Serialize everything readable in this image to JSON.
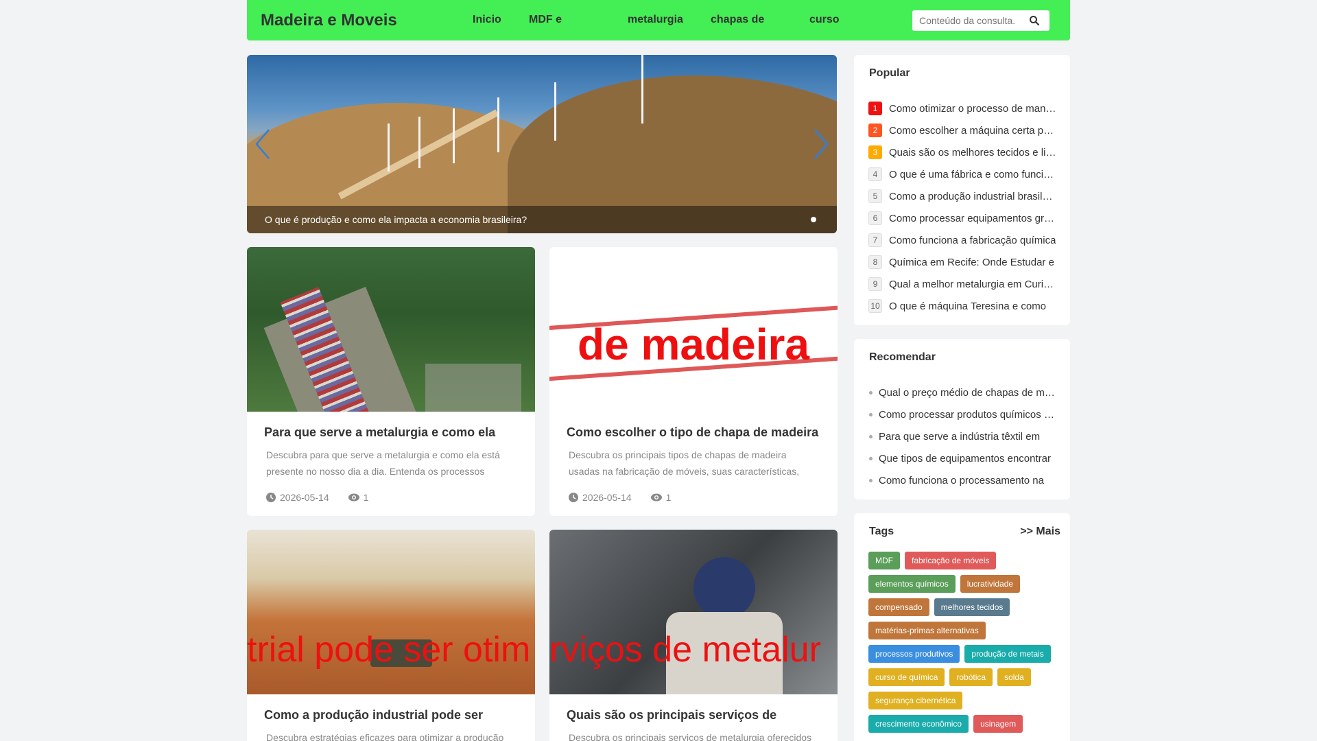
{
  "header": {
    "logo": "Madeira e Moveis",
    "nav": [
      "Inicio",
      "MDF e",
      "metalurgia",
      "chapas de",
      "curso"
    ],
    "search_placeholder": "Conteúdo da consulta.",
    "bg_color": "#44ee55"
  },
  "carousel": {
    "caption": "O que é produção e como ela impacta a economia brasileira?",
    "arrow_color": "#2d7fe0"
  },
  "cards": [
    {
      "title": "Para que serve a metalurgia e como ela",
      "desc": "Descubra para que serve a metalurgia e como ela está presente no nosso dia a dia. Entenda os processos",
      "date": "2026-05-14",
      "views": "1"
    },
    {
      "title": "Como escolher o tipo de chapa de madeira",
      "desc": "Descubra os principais tipos de chapas de madeira usadas na fabricação de móveis, suas características,",
      "date": "2026-05-14",
      "views": "1",
      "overlay": "de madeira"
    },
    {
      "title": "Como a produção industrial pode ser",
      "desc": "Descubra estratégias eficazes para otimizar a produção",
      "overlay": "trial pode ser otim"
    },
    {
      "title": "Quais são os principais serviços de",
      "desc": "Descubra os principais serviços de metalurgia oferecidos",
      "overlay": "rviços de metalur"
    }
  ],
  "popular": {
    "title": "Popular",
    "items": [
      "Como otimizar o processo de manufatura",
      "Como escolher a máquina certa para",
      "Quais são os melhores tecidos e linhas",
      "O que é uma fábrica e como funciona",
      "Como a produção industrial brasileira",
      "Como processar equipamentos grandes",
      "Como funciona a fabricação química",
      "Química em Recife: Onde Estudar e",
      "Qual a melhor metalurgia em Curitiba",
      "O que é máquina Teresina e como"
    ],
    "rank_colors": [
      "#ee1111",
      "#ff5522",
      "#ffaa00"
    ]
  },
  "recommend": {
    "title": "Recomendar",
    "items": [
      "Qual o preço médio de chapas de madeira",
      "Como processar produtos químicos com",
      "Para que serve a indústria têxtil em",
      "Que tipos de equipamentos encontrar",
      "Como funciona o processamento na"
    ]
  },
  "tags": {
    "title": "Tags",
    "more": ">> Mais",
    "items": [
      {
        "label": "MDF",
        "color": "#5a9e5a"
      },
      {
        "label": "fabricação de móveis",
        "color": "#e05a5a"
      },
      {
        "label": "elementos químicos",
        "color": "#5a9e5a"
      },
      {
        "label": "lucratividade",
        "color": "#c0763a"
      },
      {
        "label": "compensado",
        "color": "#c0763a"
      },
      {
        "label": "melhores tecidos",
        "color": "#5a7a8e"
      },
      {
        "label": "matérias-primas alternativas",
        "color": "#c0763a"
      },
      {
        "label": "processos produtivos",
        "color": "#3a8ee0"
      },
      {
        "label": "produção de metais",
        "color": "#1aabab"
      },
      {
        "label": "curso de química",
        "color": "#e0b020"
      },
      {
        "label": "robótica",
        "color": "#e0b020"
      },
      {
        "label": "solda",
        "color": "#e0b020"
      },
      {
        "label": "segurança cibernética",
        "color": "#e0b020"
      },
      {
        "label": "crescimento econômico",
        "color": "#1aabab"
      },
      {
        "label": "usinagem",
        "color": "#e05a5a"
      }
    ]
  }
}
